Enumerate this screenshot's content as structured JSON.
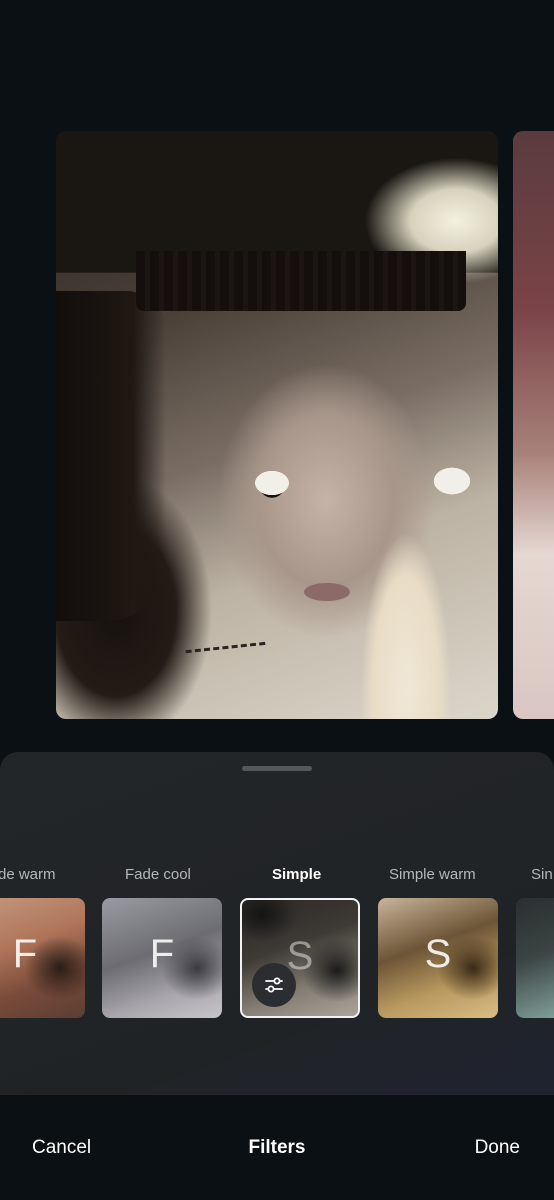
{
  "toolbar": {
    "cancel_label": "Cancel",
    "title": "Filters",
    "done_label": "Done"
  },
  "filters": {
    "selected": "Simple",
    "items": [
      {
        "label": "de warm",
        "letter": "F"
      },
      {
        "label": "Fade cool",
        "letter": "F"
      },
      {
        "label": "Simple",
        "letter": "S"
      },
      {
        "label": "Simple warm",
        "letter": "S"
      },
      {
        "label": "Sin",
        "letter": ""
      }
    ]
  },
  "icons": {
    "adjust": "sliders-icon",
    "sheet_handle": "drag-handle"
  },
  "colors": {
    "background": "#0b1014",
    "sheet": "#232629",
    "selected_border": "#f2f2f2",
    "label_inactive": "#b4b8bd",
    "label_active": "#ffffff"
  }
}
